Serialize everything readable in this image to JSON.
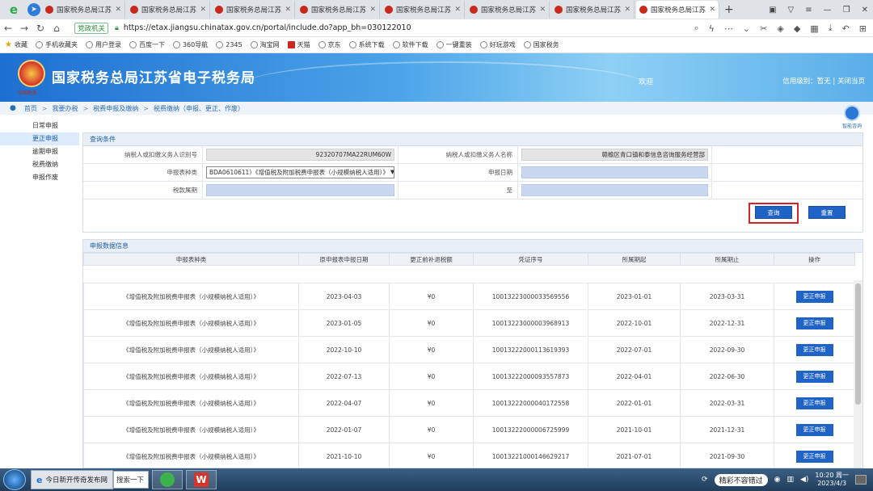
{
  "browser": {
    "tabs": [
      "国家税务总局江苏",
      "国家税务总局江苏",
      "国家税务总局江苏",
      "国家税务总局江苏",
      "国家税务总局江苏",
      "国家税务总局江苏",
      "国家税务总局江苏",
      "国家税务总局江苏"
    ],
    "badge": "党政机关",
    "url": "https://etax.jiangsu.chinatax.gov.cn/portal/include.do?app_bh=030122010",
    "bookmarks": [
      "收藏",
      "手机收藏夹",
      "用户登录",
      "百度一下",
      "360导航",
      "2345",
      "淘宝网",
      "天猫",
      "京东",
      "系统下载",
      "软件下载",
      "一键重装",
      "好玩游戏",
      "国家税务"
    ]
  },
  "header": {
    "title": "国家税务总局江苏省电子税务局",
    "welcome": "欢迎",
    "links": "信用级别：暂无 | 关闭当页",
    "emblem_sub": "中国税务"
  },
  "breadcrumb": [
    "首页",
    "我要办税",
    "税费申报及缴纳",
    "税费缴纳（申报、更正、作废）"
  ],
  "sidebar": [
    "日常申报",
    "更正申报",
    "逾期申报",
    "税费缴纳",
    "申报作废"
  ],
  "helper": "智能咨询",
  "query": {
    "title": "查询条件",
    "taxpayer_id_label": "纳税人或扣缴义务人识别号",
    "taxpayer_id": "92320707MA22RUM60W",
    "taxpayer_name_label": "纳税人或扣缴义务人名称",
    "taxpayer_name": "赣榆区青口镇和泰信息咨询服务经营部",
    "report_type_label": "申报表种类",
    "report_type": "BDA0610611）《增值税及附加税费申报表（小规模纳税人适用）》",
    "report_date_label": "申报日期",
    "tax_period_label": "税款属期",
    "to_label": "至",
    "search_btn": "查询",
    "reset_btn": "重置"
  },
  "results": {
    "title": "申报数据信息",
    "columns": [
      "申报表种类",
      "原申报表申报日期",
      "更正前补退税额",
      "凭证序号",
      "所属期起",
      "所属期止",
      "操作"
    ],
    "action_label": "更正申报",
    "rows": [
      {
        "type": "《增值税及附加税费申报表（小规模纳税人适用）》",
        "date": "2023-04-03",
        "amount": "¥0",
        "voucher": "10013223000033569556",
        "start": "2023-01-01",
        "end": "2023-03-31"
      },
      {
        "type": "《增值税及附加税费申报表（小规模纳税人适用）》",
        "date": "2023-01-05",
        "amount": "¥0",
        "voucher": "10013223000003968913",
        "start": "2022-10-01",
        "end": "2022-12-31"
      },
      {
        "type": "《增值税及附加税费申报表（小规模纳税人适用）》",
        "date": "2022-10-10",
        "amount": "¥0",
        "voucher": "10013222000113619393",
        "start": "2022-07-01",
        "end": "2022-09-30"
      },
      {
        "type": "《增值税及附加税费申报表（小规模纳税人适用）》",
        "date": "2022-07-13",
        "amount": "¥0",
        "voucher": "10013222000093557873",
        "start": "2022-04-01",
        "end": "2022-06-30"
      },
      {
        "type": "《增值税及附加税费申报表（小规模纳税人适用）》",
        "date": "2022-04-07",
        "amount": "¥0",
        "voucher": "10013222000040172558",
        "start": "2022-01-01",
        "end": "2022-03-31"
      },
      {
        "type": "《增值税及附加税费申报表（小规模纳税人适用）》",
        "date": "2022-01-07",
        "amount": "¥0",
        "voucher": "10013222000006725999",
        "start": "2021-10-01",
        "end": "2021-12-31"
      },
      {
        "type": "《增值税及附加税费申报表（小规模纳税人适用）》",
        "date": "2021-10-10",
        "amount": "¥0",
        "voucher": "10013221000146629217",
        "start": "2021-07-01",
        "end": "2021-09-30"
      }
    ]
  },
  "taskbar": {
    "news": "今日新开传奇发布网",
    "search": "搜索一下",
    "tray_msg": "精彩不容错过",
    "time": "10:20 周一",
    "date": "2023/4/3"
  },
  "colors": {
    "accent": "#1f63c6",
    "highlight": "#d2232a"
  }
}
